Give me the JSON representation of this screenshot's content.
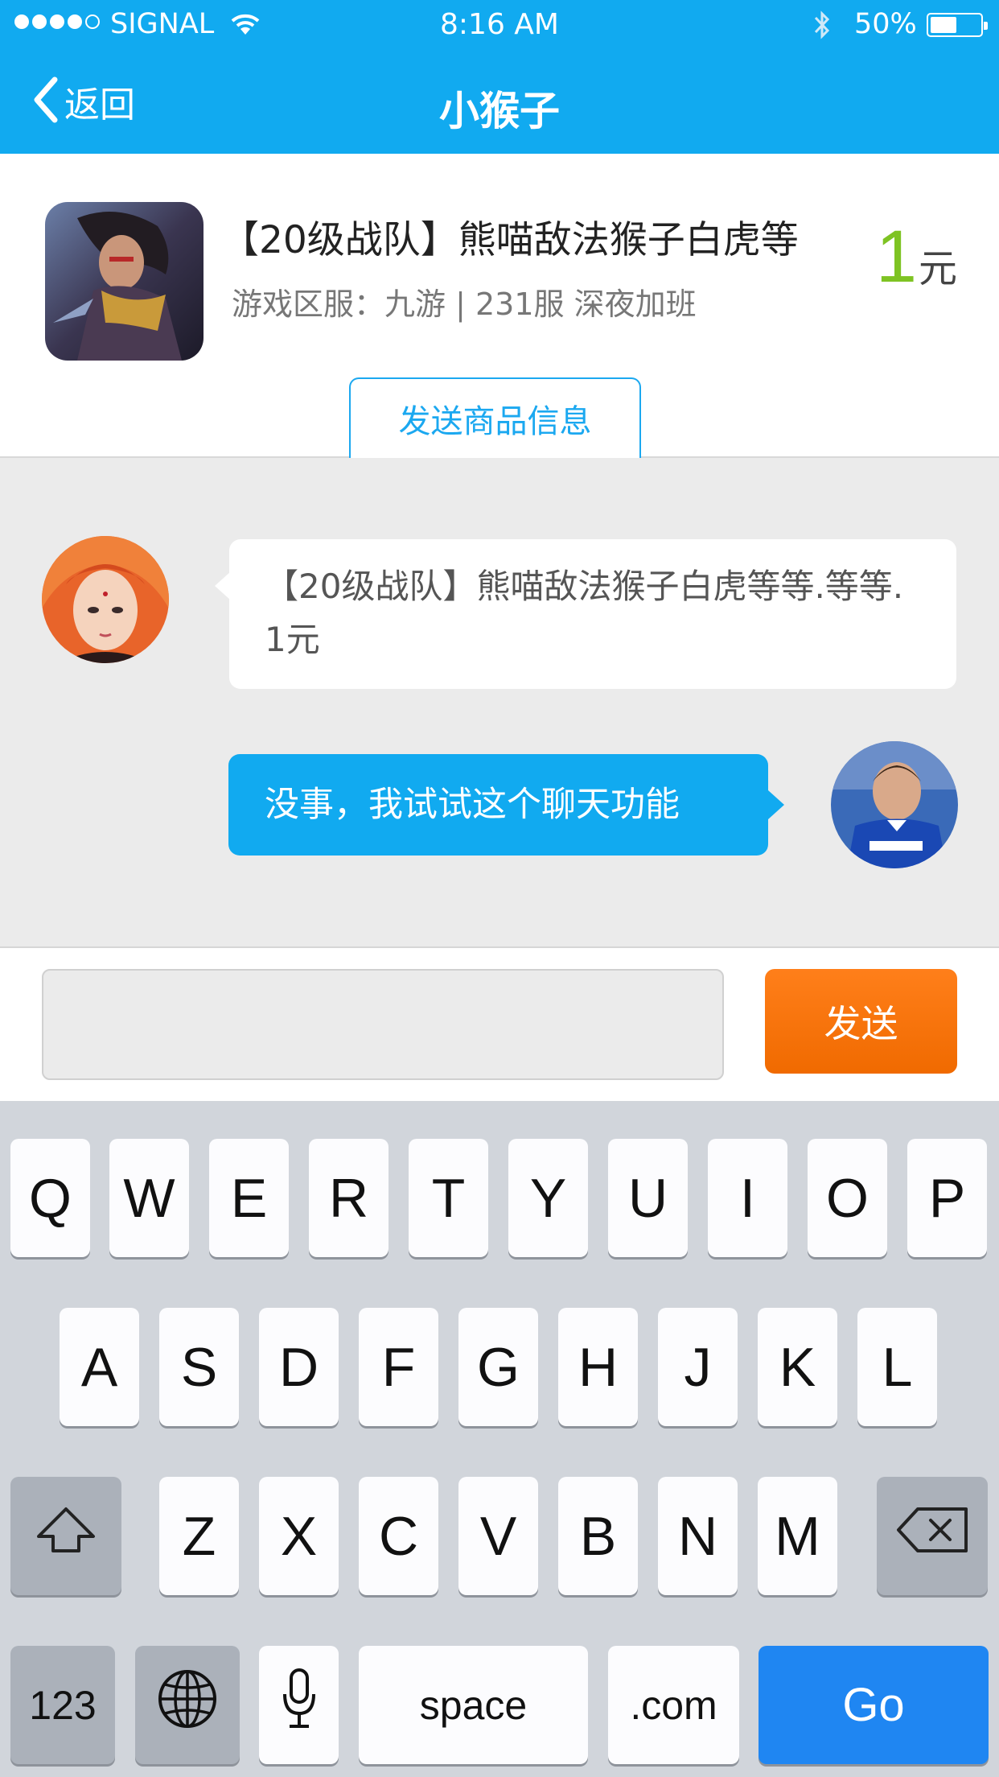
{
  "status_bar": {
    "carrier": "SIGNAL",
    "time": "8:16 AM",
    "battery": "50%",
    "battery_level": 0.5,
    "signal_bars": 4
  },
  "nav": {
    "back_label": "返回",
    "title": "小猴子"
  },
  "product": {
    "title": "【20级战队】熊喵敌法猴子白虎等",
    "server": "游戏区服：九游 | 231服 深夜加班",
    "price_value": "1",
    "price_unit": "元",
    "send_info_label": "发送商品信息"
  },
  "chat": {
    "messages": [
      {
        "from": "seller",
        "text": "【20级战队】熊喵敌法猴子白虎等等.等等. 1元"
      },
      {
        "from": "me",
        "text": "没事，我试试这个聊天功能"
      }
    ]
  },
  "input": {
    "value": "",
    "send_label": "发送"
  },
  "keyboard": {
    "row1": [
      "Q",
      "W",
      "E",
      "R",
      "T",
      "Y",
      "U",
      "I",
      "O",
      "P"
    ],
    "row2": [
      "A",
      "S",
      "D",
      "F",
      "G",
      "H",
      "J",
      "K",
      "L"
    ],
    "row3": [
      "Z",
      "X",
      "C",
      "V",
      "B",
      "N",
      "M"
    ],
    "numbers_label": "123",
    "space_label": "space",
    "dotcom_label": ".com",
    "go_label": "Go"
  },
  "colors": {
    "brand_blue": "#11aaf0",
    "price_green": "#7ec323",
    "send_orange": "#f57311",
    "go_blue": "#1f86f2"
  }
}
